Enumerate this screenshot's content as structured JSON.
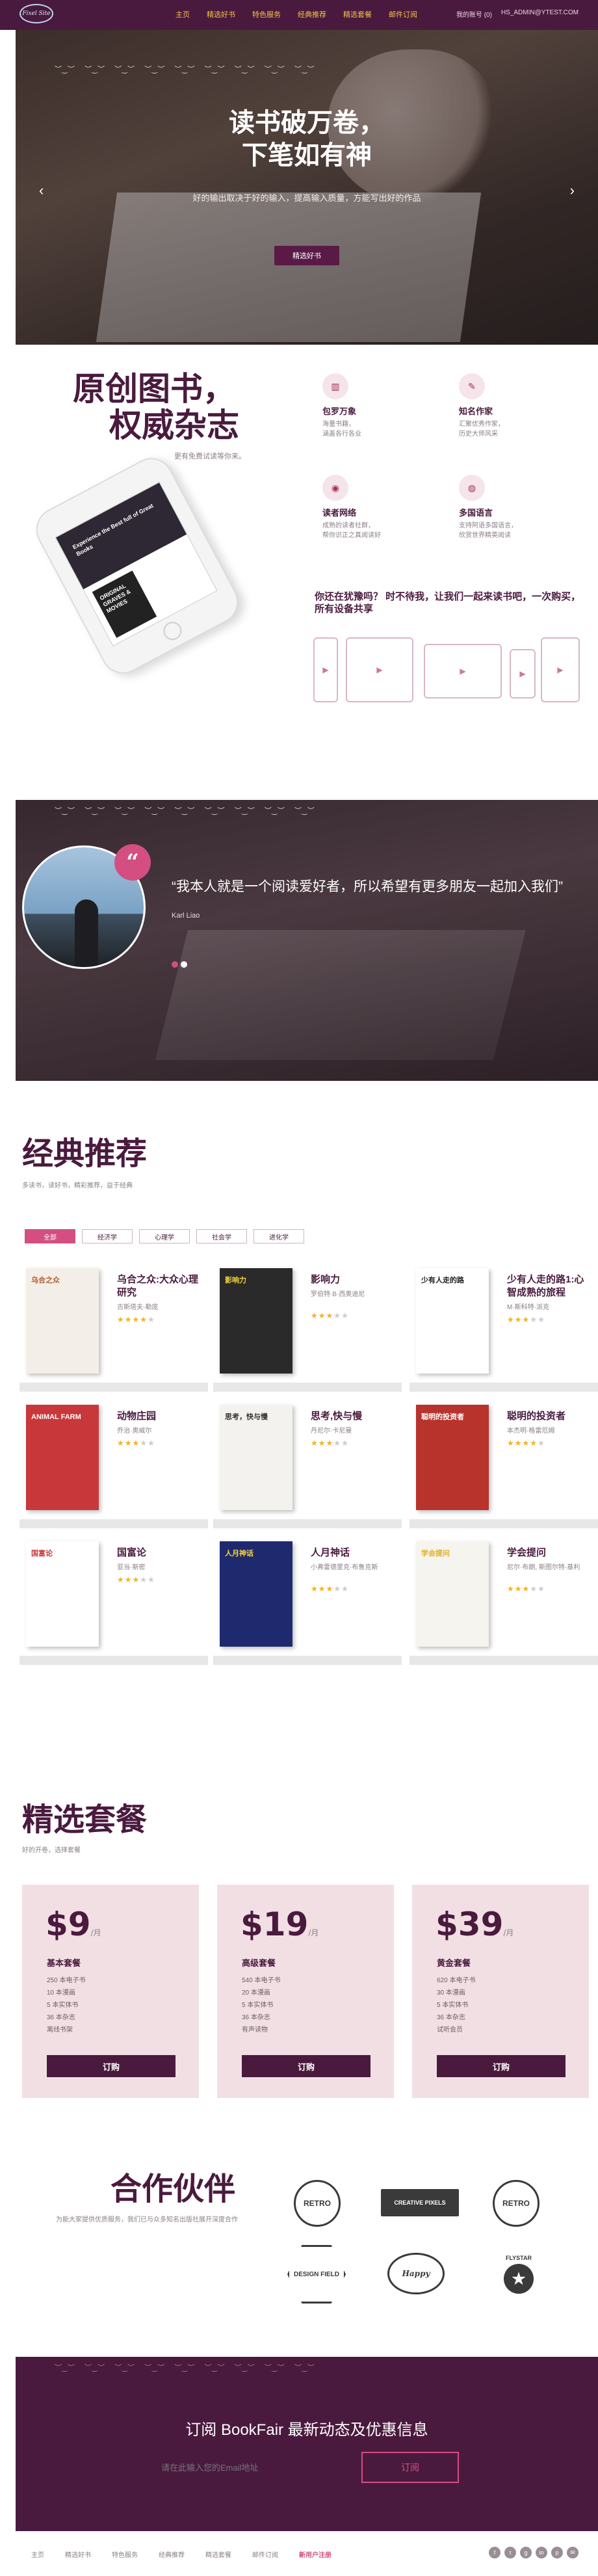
{
  "nav": {
    "logo": "Fixel Site",
    "items": [
      "主页",
      "精选好书",
      "特色服务",
      "经典推荐",
      "精选套餐",
      "邮件订阅"
    ],
    "account": "我的账号 (0)",
    "email": "HS_ADMIN@YTEST.COM"
  },
  "hero": {
    "title_line1": "读书破万卷，",
    "title_line2": "下笔如有神",
    "subtitle": "好的输出取决于好的输入，提高输入质量，方能写出好的作品",
    "button": "精选好书",
    "prev": "‹",
    "next": "›"
  },
  "magazine": {
    "title_line1": "原创图书，",
    "title_line2": "权威杂志",
    "subtitle": "更有免费试读等你来。",
    "phone_text": "Experience the Best full of Great Books",
    "phone_book": "ORIGINAL GRAVES & MOVIES",
    "features": [
      {
        "icon": "books-icon",
        "glyph": "▥",
        "title": "包罗万象",
        "desc": "海量书籍，\n涵盖各行各业"
      },
      {
        "icon": "author-icon",
        "glyph": "✎",
        "title": "知名作家",
        "desc": "汇聚优秀作家，\n历史大师风采"
      },
      {
        "icon": "network-icon",
        "glyph": "◉",
        "title": "读者网络",
        "desc": "成熟的读者社群，\n帮你识正之真阅读好"
      },
      {
        "icon": "language-icon",
        "glyph": "◍",
        "title": "多国语言",
        "desc": "支持阿语多国语言，\n欣赏世界精英阅读"
      }
    ],
    "wait_text": "你还在犹豫吗？ 时不待我，让我们一起来读书吧，一次购买，所有设备共享"
  },
  "quote": {
    "mark": "“",
    "text": "“我本人就是一个阅读爱好者，所以希望有更多朋友一起加入我们”",
    "author": "Karl Liao"
  },
  "classics": {
    "title": "经典推荐",
    "subtitle": "多读书，读好书，精彩推荐，益于经典",
    "tabs": [
      "全部",
      "经济学",
      "心理学",
      "社会学",
      "进化学"
    ],
    "books": [
      {
        "title": "乌合之众:大众心理研究",
        "author": "古斯塔夫·勒庞",
        "stars": 4,
        "cover_title": "乌合之众",
        "cover_color": "#f3efe8",
        "cover_text": "#b55a2c"
      },
      {
        "title": "影响力",
        "author": "罗伯特·B·西奥迪尼",
        "stars": 3,
        "cover_title": "影响力",
        "cover_color": "#2a2a2a",
        "cover_text": "#f5d33b"
      },
      {
        "title": "少有人走的路1:心智成熟的旅程",
        "author": "M·斯科特·派克",
        "stars": 3,
        "cover_title": "少有人走的路",
        "cover_color": "#ffffff",
        "cover_text": "#222222"
      },
      {
        "title": "动物庄园",
        "author": "乔治·奥威尔",
        "stars": 3,
        "cover_title": "ANIMAL FARM",
        "cover_color": "#c8373a",
        "cover_text": "#ffffff"
      },
      {
        "title": "思考,快与慢",
        "author": "丹尼尔·卡尼曼",
        "stars": 3,
        "cover_title": "思考，快与慢",
        "cover_color": "#f4f2ee",
        "cover_text": "#333333"
      },
      {
        "title": "聪明的投资者",
        "author": "本杰明·格雷厄姆",
        "stars": 4,
        "cover_title": "聪明的投资者",
        "cover_color": "#b8332c",
        "cover_text": "#ffffff"
      },
      {
        "title": "国富论",
        "author": "亚当·斯密",
        "stars": 3,
        "cover_title": "国富论",
        "cover_color": "#ffffff",
        "cover_text": "#c8373a"
      },
      {
        "title": "人月神话",
        "author": "小弗雷德里克·布鲁克斯",
        "stars": 3,
        "cover_title": "人月神话",
        "cover_color": "#1f2a6e",
        "cover_text": "#f5d33b"
      },
      {
        "title": "学会提问",
        "author": "尼尔·布朗, 斯图尔特·基利",
        "stars": 3,
        "cover_title": "学会提问",
        "cover_color": "#f6f4ef",
        "cover_text": "#e0b11c"
      }
    ]
  },
  "plans": {
    "title": "精选套餐",
    "subtitle": "好的开卷，选择套餐",
    "per": "/月",
    "buy": "订购",
    "items": [
      {
        "price": "$9",
        "name": "基本套餐",
        "features": [
          "250 本电子书",
          "10 本漫画",
          "5 本实体书",
          "36 本杂志",
          "离线书架"
        ]
      },
      {
        "price": "$19",
        "name": "高级套餐",
        "features": [
          "540 本电子书",
          "20 本漫画",
          "5 本实体书",
          "36 本杂志",
          "有声读物"
        ]
      },
      {
        "price": "$39",
        "name": "黄金套餐",
        "features": [
          "620 本电子书",
          "30 本漫画",
          "5 本实体书",
          "36 本杂志",
          "试听会员"
        ]
      }
    ]
  },
  "partners": {
    "title": "合作伙伴",
    "subtitle": "为能大家提供优质服务，我们已与众多知名出版社展开深度合作",
    "logos": [
      "RETRO",
      "CREATIVE PIXELS",
      "RETRO",
      "DESIGN FIELD",
      "Happy",
      "FLYSTAR"
    ]
  },
  "newsletter": {
    "title": "订阅 BookFair 最新动态及优惠信息",
    "placeholder": "请在此输入您的Email地址",
    "button": "订阅"
  },
  "footer": {
    "items": [
      "主页",
      "精选好书",
      "特色服务",
      "经典推荐",
      "精选套餐",
      "邮件订阅",
      "新用户注册"
    ],
    "social": [
      "f",
      "t",
      "g",
      "in",
      "p",
      "✉"
    ]
  }
}
